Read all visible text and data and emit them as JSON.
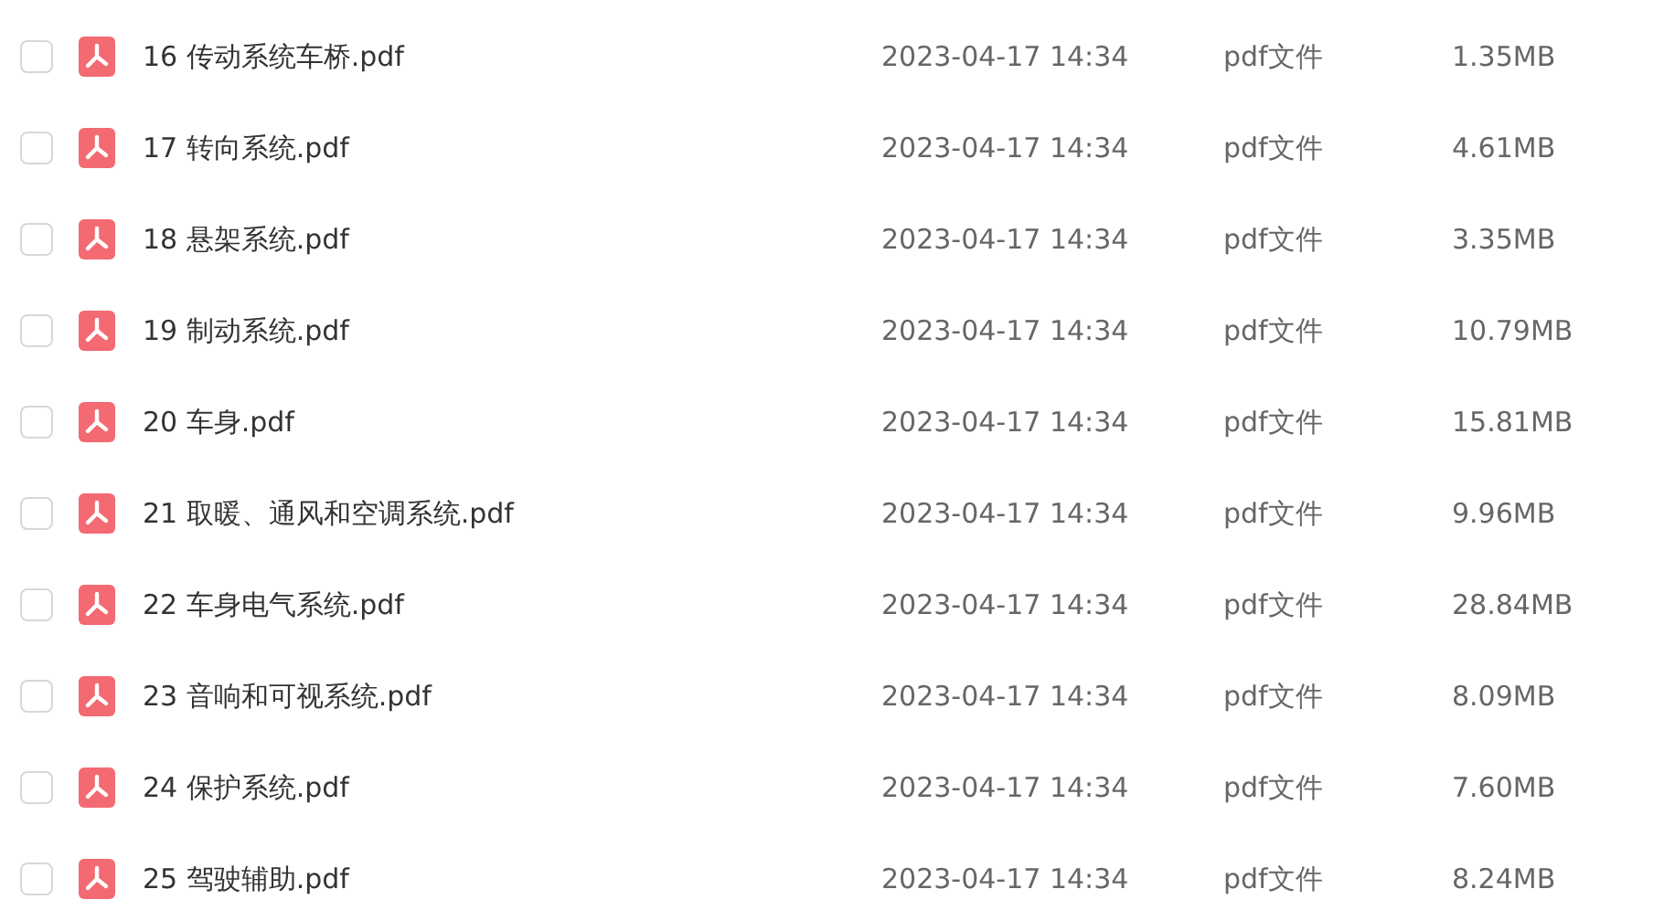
{
  "files": [
    {
      "name": "16 传动系统车桥.pdf",
      "modified": "2023-04-17 14:34",
      "type": "pdf文件",
      "size": "1.35MB",
      "checked": false
    },
    {
      "name": "17 转向系统.pdf",
      "modified": "2023-04-17 14:34",
      "type": "pdf文件",
      "size": "4.61MB",
      "checked": false
    },
    {
      "name": "18 悬架系统.pdf",
      "modified": "2023-04-17 14:34",
      "type": "pdf文件",
      "size": "3.35MB",
      "checked": false
    },
    {
      "name": "19 制动系统.pdf",
      "modified": "2023-04-17 14:34",
      "type": "pdf文件",
      "size": "10.79MB",
      "checked": false
    },
    {
      "name": "20 车身.pdf",
      "modified": "2023-04-17 14:34",
      "type": "pdf文件",
      "size": "15.81MB",
      "checked": false
    },
    {
      "name": "21 取暖、通风和空调系统.pdf",
      "modified": "2023-04-17 14:34",
      "type": "pdf文件",
      "size": "9.96MB",
      "checked": false
    },
    {
      "name": "22 车身电气系统.pdf",
      "modified": "2023-04-17 14:34",
      "type": "pdf文件",
      "size": "28.84MB",
      "checked": false
    },
    {
      "name": "23 音响和可视系统.pdf",
      "modified": "2023-04-17 14:34",
      "type": "pdf文件",
      "size": "8.09MB",
      "checked": false
    },
    {
      "name": "24 保护系统.pdf",
      "modified": "2023-04-17 14:34",
      "type": "pdf文件",
      "size": "7.60MB",
      "checked": false
    },
    {
      "name": "25 驾驶辅助.pdf",
      "modified": "2023-04-17 14:34",
      "type": "pdf文件",
      "size": "8.24MB",
      "checked": false
    }
  ]
}
